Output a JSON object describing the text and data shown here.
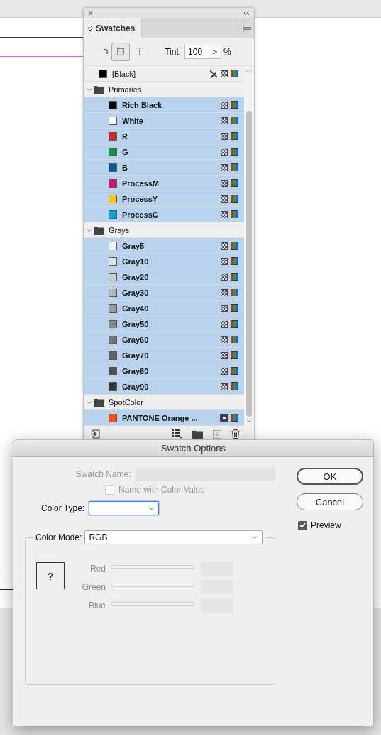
{
  "panel": {
    "tab": "Swatches",
    "text_toggle": "T",
    "tint_label": "Tint:",
    "tint_value": "100",
    "stepper": ">",
    "tint_unit": "%",
    "items": [
      {
        "kind": "swatch",
        "name": "[Black]",
        "color": "#000000",
        "selected": false,
        "locked": true,
        "spot": false
      },
      {
        "kind": "group",
        "name": "Primaries",
        "selected": false,
        "expanded": true,
        "children": [
          {
            "kind": "swatch",
            "name": "Rich Black",
            "color": "#0a0a0a",
            "selected": true,
            "locked": false,
            "spot": false
          },
          {
            "kind": "swatch",
            "name": "White",
            "color": "#ffffff",
            "selected": true,
            "locked": false,
            "spot": false
          },
          {
            "kind": "swatch",
            "name": "R",
            "color": "#e01b22",
            "selected": true,
            "locked": false,
            "spot": false
          },
          {
            "kind": "swatch",
            "name": "G",
            "color": "#07924a",
            "selected": true,
            "locked": false,
            "spot": false
          },
          {
            "kind": "swatch",
            "name": "B",
            "color": "#0a56a0",
            "selected": true,
            "locked": false,
            "spot": false
          },
          {
            "kind": "swatch",
            "name": "ProcessM",
            "color": "#e0077f",
            "selected": true,
            "locked": false,
            "spot": false
          },
          {
            "kind": "swatch",
            "name": "ProcessY",
            "color": "#ffc600",
            "selected": true,
            "locked": false,
            "spot": false
          },
          {
            "kind": "swatch",
            "name": "ProcessC",
            "color": "#07a0e0",
            "selected": true,
            "locked": false,
            "spot": false
          }
        ]
      },
      {
        "kind": "group",
        "name": "Grays",
        "selected": false,
        "expanded": true,
        "children": [
          {
            "kind": "swatch",
            "name": "Gray5",
            "color": "#f3f3f3",
            "selected": true,
            "locked": false,
            "spot": false
          },
          {
            "kind": "swatch",
            "name": "Gray10",
            "color": "#e5e5e5",
            "selected": true,
            "locked": false,
            "spot": false
          },
          {
            "kind": "swatch",
            "name": "Gray20",
            "color": "#cdcdcd",
            "selected": true,
            "locked": false,
            "spot": false
          },
          {
            "kind": "swatch",
            "name": "Gray30",
            "color": "#b4b4b4",
            "selected": true,
            "locked": false,
            "spot": false
          },
          {
            "kind": "swatch",
            "name": "Gray40",
            "color": "#9c9c9c",
            "selected": true,
            "locked": false,
            "spot": false
          },
          {
            "kind": "swatch",
            "name": "Gray50",
            "color": "#888888",
            "selected": true,
            "locked": false,
            "spot": false
          },
          {
            "kind": "swatch",
            "name": "Gray60",
            "color": "#747474",
            "selected": true,
            "locked": false,
            "spot": false
          },
          {
            "kind": "swatch",
            "name": "Gray70",
            "color": "#626262",
            "selected": true,
            "locked": false,
            "spot": false
          },
          {
            "kind": "swatch",
            "name": "Gray80",
            "color": "#4e4e4e",
            "selected": true,
            "locked": false,
            "spot": false
          },
          {
            "kind": "swatch",
            "name": "Gray90",
            "color": "#333333",
            "selected": true,
            "locked": false,
            "spot": false
          }
        ]
      },
      {
        "kind": "group",
        "name": "SpotColor",
        "selected": false,
        "expanded": true,
        "children": [
          {
            "kind": "swatch",
            "name": "PANTONE Orange ...",
            "color": "#fe5000",
            "selected": true,
            "locked": false,
            "spot": true
          }
        ]
      }
    ]
  },
  "dialog": {
    "title": "Swatch Options",
    "swatch_name": {
      "label": "Swatch Name:",
      "disabled": true
    },
    "name_with_value": {
      "label": "Name with Color Value",
      "checked": false,
      "disabled": true
    },
    "color_type": {
      "label": "Color Type:",
      "focused": true
    },
    "buttons": [
      {
        "label": "OK",
        "default": true
      },
      {
        "label": "Cancel",
        "default": false
      }
    ],
    "preview": {
      "label": "Preview",
      "checked": true
    },
    "color_mode": {
      "label": "Color Mode:",
      "value": "RGB"
    },
    "preview_swatch": "?",
    "channels": [
      {
        "name": "Red",
        "disabled": true
      },
      {
        "name": "Green",
        "disabled": true
      },
      {
        "name": "Blue",
        "disabled": true
      }
    ]
  }
}
